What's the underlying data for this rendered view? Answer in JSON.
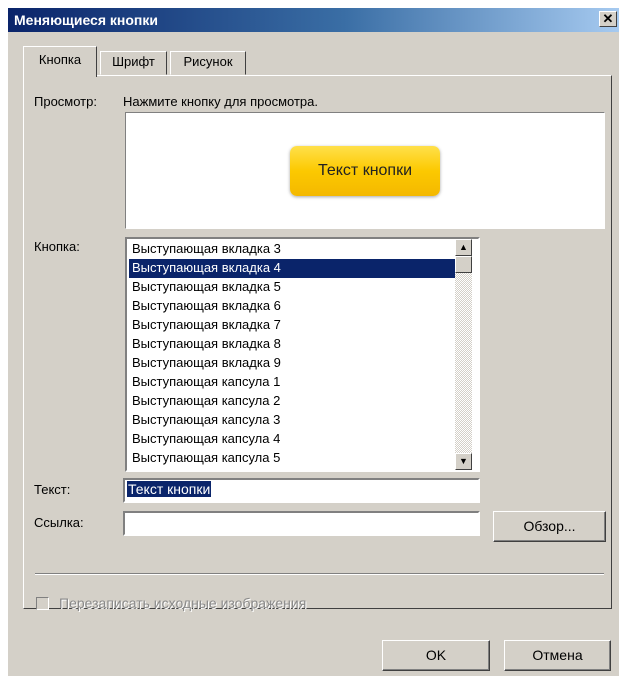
{
  "window": {
    "title": "Меняющиеся кнопки",
    "close_glyph": "✕"
  },
  "tabs": [
    {
      "label": "Кнопка",
      "active": true
    },
    {
      "label": "Шрифт",
      "active": false
    },
    {
      "label": "Рисунок",
      "active": false
    }
  ],
  "preview": {
    "label": "Просмотр:",
    "hint": "Нажмите кнопку для просмотра.",
    "button_text": "Текст кнопки",
    "button_color": "#fcc900"
  },
  "button_list": {
    "label": "Кнопка:",
    "items": [
      "Выступающая вкладка 3",
      "Выступающая вкладка 4",
      "Выступающая вкладка 5",
      "Выступающая вкладка 6",
      "Выступающая вкладка 7",
      "Выступающая вкладка 8",
      "Выступающая вкладка 9",
      "Выступающая капсула 1",
      "Выступающая капсула 2",
      "Выступающая капсула 3",
      "Выступающая капсула 4",
      "Выступающая капсула 5"
    ],
    "selected_index": 1,
    "scroll_up_icon": "▲",
    "scroll_down_icon": "▼"
  },
  "text_field": {
    "label": "Текст:",
    "value": "Текст кнопки"
  },
  "link_field": {
    "label": "Ссылка:",
    "value": ""
  },
  "browse_button": "Обзор...",
  "overwrite_checkbox": {
    "label": "Перезаписать исходные изображения",
    "checked": false,
    "disabled": true
  },
  "footer": {
    "ok_label": "OK",
    "cancel_label": "Отмена"
  },
  "colors": {
    "selection": "#0a246a",
    "dialog_bg": "#d4d0c8"
  }
}
